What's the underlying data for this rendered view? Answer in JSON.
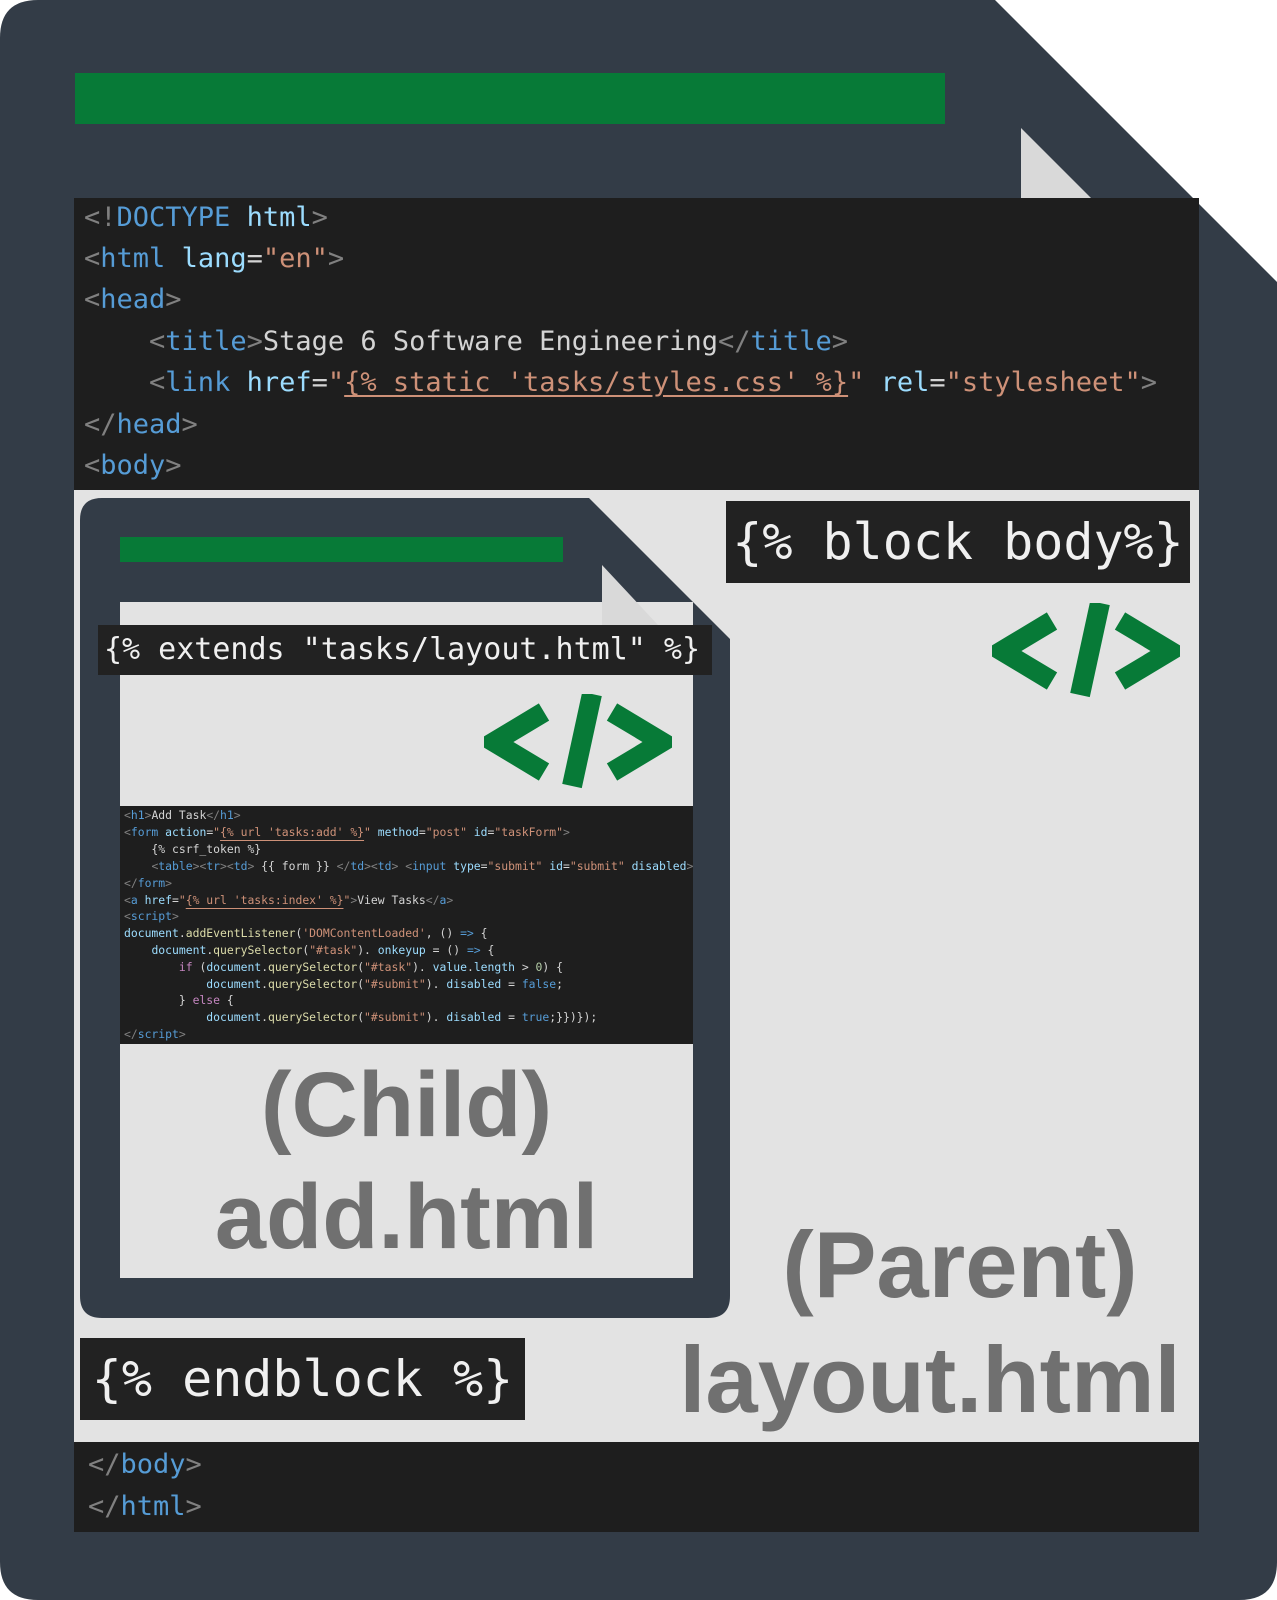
{
  "parent": {
    "code_top": [
      [
        [
          "t-tag",
          "<!"
        ],
        [
          "t-name",
          "DOCTYPE"
        ],
        [
          "t-txt",
          " "
        ],
        [
          "t-attr",
          "html"
        ],
        [
          "t-tag",
          ">"
        ]
      ],
      [
        [
          "t-tag",
          "<"
        ],
        [
          "t-name",
          "html"
        ],
        [
          "t-txt",
          " "
        ],
        [
          "t-attr",
          "lang"
        ],
        [
          "t-txt",
          "="
        ],
        [
          "t-str",
          "\"en\""
        ],
        [
          "t-tag",
          ">"
        ]
      ],
      [
        [
          "t-tag",
          "<"
        ],
        [
          "t-name",
          "head"
        ],
        [
          "t-tag",
          ">"
        ]
      ],
      [
        [
          "t-txt",
          "    "
        ],
        [
          "t-tag",
          "<"
        ],
        [
          "t-name",
          "title"
        ],
        [
          "t-tag",
          ">"
        ],
        [
          "t-txt",
          "Stage 6 Software Engineering"
        ],
        [
          "t-tag",
          "</"
        ],
        [
          "t-name",
          "title"
        ],
        [
          "t-tag",
          ">"
        ]
      ],
      [
        [
          "t-txt",
          "    "
        ],
        [
          "t-tag",
          "<"
        ],
        [
          "t-name",
          "link"
        ],
        [
          "t-txt",
          " "
        ],
        [
          "t-attr",
          "href"
        ],
        [
          "t-txt",
          "="
        ],
        [
          "t-str",
          "\""
        ],
        [
          "t-tpl",
          "{% static 'tasks/styles.css' %}"
        ],
        [
          "t-str",
          "\""
        ],
        [
          "t-txt",
          " "
        ],
        [
          "t-attr",
          "rel"
        ],
        [
          "t-txt",
          "="
        ],
        [
          "t-str",
          "\"stylesheet\""
        ],
        [
          "t-tag",
          ">"
        ]
      ],
      [
        [
          "t-tag",
          "</"
        ],
        [
          "t-name",
          "head"
        ],
        [
          "t-tag",
          ">"
        ]
      ],
      [
        [
          "t-tag",
          "<"
        ],
        [
          "t-name",
          "body"
        ],
        [
          "t-tag",
          ">"
        ]
      ]
    ],
    "code_bottom": [
      [
        [
          "t-tag",
          "</"
        ],
        [
          "t-name",
          "body"
        ],
        [
          "t-tag",
          ">"
        ]
      ],
      [
        [
          "t-tag",
          "</"
        ],
        [
          "t-name",
          "html"
        ],
        [
          "t-tag",
          ">"
        ]
      ]
    ],
    "block_tag": "{% block body%}",
    "endblock_tag": "{% endblock %}",
    "role": "(Parent)",
    "filename": "layout.html"
  },
  "child": {
    "extends_tag": "{% extends \"tasks/layout.html\" %}",
    "code": [
      [
        [
          "t-tag",
          "<"
        ],
        [
          "t-name",
          "h1"
        ],
        [
          "t-tag",
          ">"
        ],
        [
          "t-txt",
          "Add Task"
        ],
        [
          "t-tag",
          "</"
        ],
        [
          "t-name",
          "h1"
        ],
        [
          "t-tag",
          ">"
        ]
      ],
      [
        [
          "t-tag",
          "<"
        ],
        [
          "t-name",
          "form"
        ],
        [
          "t-txt",
          " "
        ],
        [
          "t-attr",
          "action"
        ],
        [
          "t-txt",
          "="
        ],
        [
          "t-str",
          "\""
        ],
        [
          "t-tpl",
          "{% url 'tasks:add' %}"
        ],
        [
          "t-str",
          "\""
        ],
        [
          "t-txt",
          " "
        ],
        [
          "t-attr",
          "method"
        ],
        [
          "t-txt",
          "="
        ],
        [
          "t-str",
          "\"post\""
        ],
        [
          "t-txt",
          " "
        ],
        [
          "t-attr",
          "id"
        ],
        [
          "t-txt",
          "="
        ],
        [
          "t-str",
          "\"taskForm\""
        ],
        [
          "t-tag",
          ">"
        ]
      ],
      [
        [
          "t-txt",
          "    {% csrf_token %}"
        ]
      ],
      [
        [
          "t-txt",
          "    "
        ],
        [
          "t-tag",
          "<"
        ],
        [
          "t-name",
          "table"
        ],
        [
          "t-tag",
          "><"
        ],
        [
          "t-name",
          "tr"
        ],
        [
          "t-tag",
          "><"
        ],
        [
          "t-name",
          "td"
        ],
        [
          "t-tag",
          ">"
        ],
        [
          "t-txt",
          " {{ form }} "
        ],
        [
          "t-tag",
          "</"
        ],
        [
          "t-name",
          "td"
        ],
        [
          "t-tag",
          "><"
        ],
        [
          "t-name",
          "td"
        ],
        [
          "t-tag",
          ">"
        ],
        [
          "t-txt",
          " "
        ],
        [
          "t-tag",
          "<"
        ],
        [
          "t-name",
          "input"
        ],
        [
          "t-txt",
          " "
        ],
        [
          "t-attr",
          "type"
        ],
        [
          "t-txt",
          "="
        ],
        [
          "t-str",
          "\"submit\""
        ],
        [
          "t-txt",
          " "
        ],
        [
          "t-attr",
          "id"
        ],
        [
          "t-txt",
          "="
        ],
        [
          "t-str",
          "\"submit\""
        ],
        [
          "t-txt",
          " "
        ],
        [
          "t-attr",
          "disabled"
        ],
        [
          "t-tag",
          ">"
        ]
      ],
      [
        [
          "t-tag",
          "</"
        ],
        [
          "t-name",
          "form"
        ],
        [
          "t-tag",
          ">"
        ]
      ],
      [
        [
          "t-tag",
          "<"
        ],
        [
          "t-name",
          "a"
        ],
        [
          "t-txt",
          " "
        ],
        [
          "t-attr",
          "href"
        ],
        [
          "t-txt",
          "="
        ],
        [
          "t-str",
          "\""
        ],
        [
          "t-tpl",
          "{% url 'tasks:index' %}"
        ],
        [
          "t-str",
          "\""
        ],
        [
          "t-tag",
          ">"
        ],
        [
          "t-txt",
          "View Tasks"
        ],
        [
          "t-tag",
          "</"
        ],
        [
          "t-name",
          "a"
        ],
        [
          "t-tag",
          ">"
        ]
      ],
      [
        [
          "t-tag",
          "<"
        ],
        [
          "t-name",
          "script"
        ],
        [
          "t-tag",
          ">"
        ]
      ],
      [
        [
          "t-attr",
          "document"
        ],
        [
          "t-txt",
          "."
        ],
        [
          "t-fn",
          "addEventListener"
        ],
        [
          "t-txt",
          "("
        ],
        [
          "t-str",
          "'DOMContentLoaded'"
        ],
        [
          "t-txt",
          ", () "
        ],
        [
          "t-name",
          "=>"
        ],
        [
          "t-txt",
          " {"
        ]
      ],
      [
        [
          "t-txt",
          "    "
        ],
        [
          "t-attr",
          "document"
        ],
        [
          "t-txt",
          "."
        ],
        [
          "t-fn",
          "querySelector"
        ],
        [
          "t-txt",
          "("
        ],
        [
          "t-str",
          "\"#task\""
        ],
        [
          "t-txt",
          "). "
        ],
        [
          "t-attr",
          "onkeyup"
        ],
        [
          "t-txt",
          " = () "
        ],
        [
          "t-name",
          "=>"
        ],
        [
          "t-txt",
          " {"
        ]
      ],
      [
        [
          "t-txt",
          "        "
        ],
        [
          "t-kw",
          "if"
        ],
        [
          "t-txt",
          " ("
        ],
        [
          "t-attr",
          "document"
        ],
        [
          "t-txt",
          "."
        ],
        [
          "t-fn",
          "querySelector"
        ],
        [
          "t-txt",
          "("
        ],
        [
          "t-str",
          "\"#task\""
        ],
        [
          "t-txt",
          "). "
        ],
        [
          "t-attr",
          "value"
        ],
        [
          "t-txt",
          "."
        ],
        [
          "t-attr",
          "length"
        ],
        [
          "t-txt",
          " > "
        ],
        [
          "t-num",
          "0"
        ],
        [
          "t-txt",
          ") {"
        ]
      ],
      [
        [
          "t-txt",
          "            "
        ],
        [
          "t-attr",
          "document"
        ],
        [
          "t-txt",
          "."
        ],
        [
          "t-fn",
          "querySelector"
        ],
        [
          "t-txt",
          "("
        ],
        [
          "t-str",
          "\"#submit\""
        ],
        [
          "t-txt",
          "). "
        ],
        [
          "t-attr",
          "disabled"
        ],
        [
          "t-txt",
          " = "
        ],
        [
          "t-name",
          "false"
        ],
        [
          "t-txt",
          ";"
        ]
      ],
      [
        [
          "t-txt",
          "        } "
        ],
        [
          "t-kw",
          "else"
        ],
        [
          "t-txt",
          " {"
        ]
      ],
      [
        [
          "t-txt",
          "            "
        ],
        [
          "t-attr",
          "document"
        ],
        [
          "t-txt",
          "."
        ],
        [
          "t-fn",
          "querySelector"
        ],
        [
          "t-txt",
          "("
        ],
        [
          "t-str",
          "\"#submit\""
        ],
        [
          "t-txt",
          "). "
        ],
        [
          "t-attr",
          "disabled"
        ],
        [
          "t-txt",
          " = "
        ],
        [
          "t-name",
          "true"
        ],
        [
          "t-txt",
          ";}})});"
        ]
      ],
      [
        [
          "t-tag",
          "</"
        ],
        [
          "t-name",
          "script"
        ],
        [
          "t-tag",
          ">"
        ]
      ]
    ],
    "role": "(Child)",
    "filename": "add.html"
  },
  "colors": {
    "frame": "#333c47",
    "page": "#e3e3e3",
    "accent_green": "#077a37",
    "fold": "#d9d9d9"
  },
  "icons": [
    "file-icon",
    "code-icon"
  ]
}
